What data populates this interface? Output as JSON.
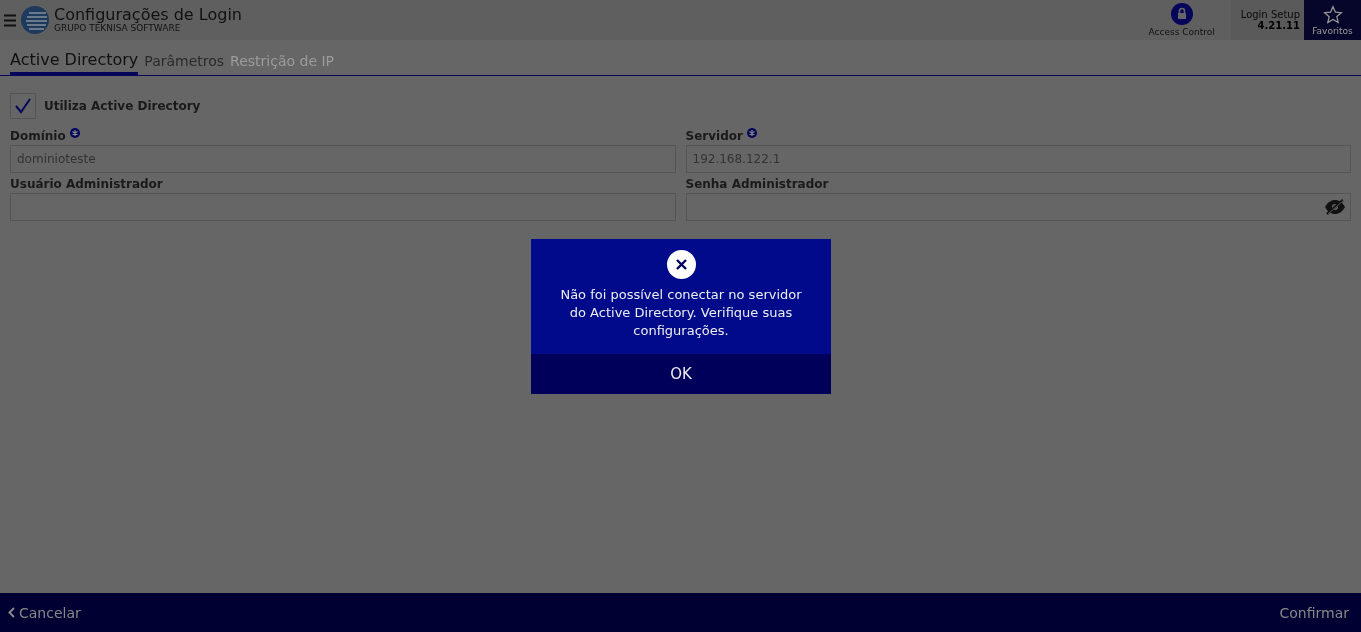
{
  "header": {
    "title": "Configurações de Login",
    "subtitle": "GRUPO TEKNISA SOFTWARE",
    "access_control": "Access Control",
    "app_name": "Login Setup",
    "version": "4.21.11",
    "favorites": "Favoritos"
  },
  "tabs": [
    {
      "label": "Active Directory",
      "selected": true,
      "disabled": false
    },
    {
      "label": "Parâmetros",
      "selected": false,
      "disabled": false
    },
    {
      "label": "Restrição de IP",
      "selected": false,
      "disabled": true
    }
  ],
  "checkbox": {
    "label": "Utiliza Active Directory",
    "checked": true
  },
  "fields": [
    {
      "label": "Domínio",
      "required": true,
      "value": "dominioteste",
      "kind": "text"
    },
    {
      "label": "Servidor",
      "required": true,
      "value": "192.168.122.1",
      "kind": "text"
    },
    {
      "label": "Usuário Administrador",
      "required": false,
      "kind": "text"
    },
    {
      "label": "Senha Administrador",
      "required": false,
      "kind": "password"
    }
  ],
  "dialog": {
    "message": "Não foi possível conectar no servidor do Active Directory. Verifique suas configurações.",
    "button": "OK"
  },
  "footer": {
    "cancel": "Cancelar",
    "confirm": "Confirmar"
  }
}
